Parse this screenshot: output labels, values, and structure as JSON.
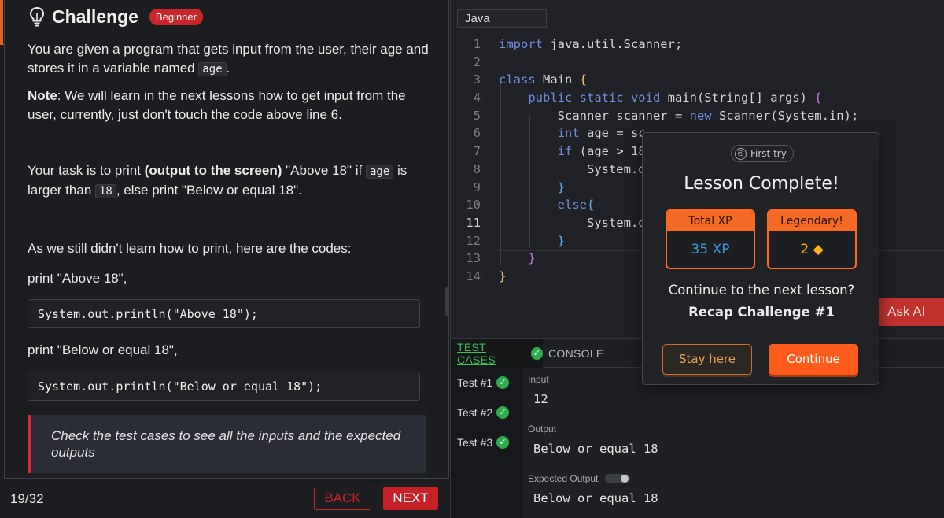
{
  "challenge": {
    "title": "Challenge",
    "badge": "Beginner",
    "intro_pre": "You are given a program that gets input from the user, their age and stores it in a variable named ",
    "intro_var": "age",
    "intro_post": ".",
    "note_label": "Note",
    "note_text": ": We will learn in the next lessons how to get input from the user, currently, just don't touch the code above line 6.",
    "task_pre": "Your task is to print ",
    "task_bold": "(output to the screen)",
    "task_mid": " \"Above 18\" if ",
    "task_var": "age",
    "task_mid2": " is larger than ",
    "task_num": "18",
    "task_post": ", else print \"Below or equal 18\".",
    "codes_intro": "As we still didn't learn how to print, here are the codes:",
    "print_above_label": "print \"Above 18\",",
    "print_above_code": "System.out.println(\"Above 18\");",
    "print_below_label": "print \"Below or equal 18\",",
    "print_below_code": "System.out.println(\"Below or equal 18\");",
    "hint": "Check the test cases to see all the inputs and the expected outputs"
  },
  "footer": {
    "progress": "19/32",
    "back": "BACK",
    "next": "NEXT"
  },
  "editor": {
    "language": "Java",
    "line_numbers": [
      "1",
      "2",
      "3",
      "4",
      "5",
      "6",
      "7",
      "8",
      "9",
      "10",
      "11",
      "12",
      "13",
      "14"
    ],
    "active_line": "11"
  },
  "tests": {
    "tab_tests": "TEST CASES",
    "tab_console": "CONSOLE",
    "items": [
      "Test #1",
      "Test #2",
      "Test #3"
    ],
    "input_label": "Input",
    "input_value": "12",
    "output_label": "Output",
    "output_value": "Below or equal 18",
    "expected_label": "Expected Output",
    "expected_value": "Below or equal 18"
  },
  "ask_ai": "Ask AI",
  "modal": {
    "first_try": "First try",
    "title": "Lesson Complete!",
    "total_xp_label": "Total XP",
    "total_xp_value": "35 XP",
    "legendary_label": "Legendary!",
    "legendary_value": "2",
    "question": "Continue to the next lesson?",
    "next_lesson": "Recap Challenge #1",
    "stay": "Stay here",
    "continue": "Continue"
  },
  "icons": {
    "bulb": "lightbulb-icon",
    "check": "check-circle-icon",
    "diamond": "diamond-icon",
    "first_try": "target-icon"
  },
  "colors": {
    "accent_red": "#c62127",
    "accent_orange": "#ff5c1c",
    "success_green": "#2fad4a"
  }
}
